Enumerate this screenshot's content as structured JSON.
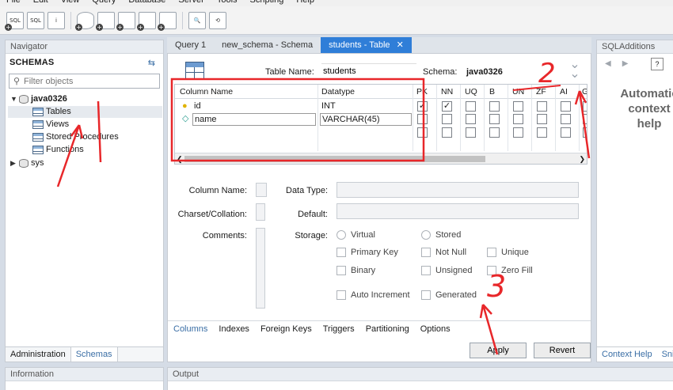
{
  "menu": [
    "File",
    "Edit",
    "View",
    "Query",
    "Database",
    "Server",
    "Tools",
    "Scripting",
    "Help"
  ],
  "toolbar": {
    "buttons": [
      {
        "icon": "new-sql-tab-icon",
        "text": "SQL"
      },
      {
        "icon": "open-sql-script-icon",
        "text": "SQL"
      },
      {
        "icon": "inspector-icon",
        "text": "i"
      },
      {
        "icon": "create-schema-icon",
        "text": ""
      },
      {
        "icon": "create-table-icon",
        "text": ""
      },
      {
        "icon": "create-view-icon",
        "text": ""
      },
      {
        "icon": "create-procedure-icon",
        "text": ""
      },
      {
        "icon": "create-function-icon",
        "text": ""
      },
      {
        "icon": "search-table-data-icon",
        "text": ""
      },
      {
        "icon": "reconnect-icon",
        "text": ""
      }
    ]
  },
  "navigator": {
    "title": "Navigator",
    "schemas_title": "SCHEMAS",
    "filter_placeholder": "Filter objects",
    "tree": {
      "db1": "java0326",
      "tables": "Tables",
      "views": "Views",
      "procedures": "Stored Procedures",
      "functions": "Functions",
      "db2": "sys"
    },
    "tabs": {
      "administration": "Administration",
      "schemas": "Schemas"
    }
  },
  "information": {
    "title": "Information"
  },
  "editor": {
    "tabs": [
      "Query 1",
      "new_schema - Schema",
      "students - Table"
    ],
    "close_glyph": "✕",
    "table_name_label": "Table Name:",
    "table_name_value": "students",
    "schema_label": "Schema:",
    "schema_value": "java0326",
    "grid": {
      "headers": [
        "Column Name",
        "Datatype",
        "PK",
        "NN",
        "UQ",
        "B",
        "UN",
        "ZF",
        "AI",
        "G"
      ],
      "rows": [
        {
          "name": "id",
          "datatype": "INT",
          "pk": true,
          "nn": true
        },
        {
          "name": "name",
          "datatype": "VARCHAR(45)",
          "pk": false,
          "nn": false
        }
      ]
    },
    "form": {
      "column_name_label": "Column Name:",
      "charset_label": "Charset/Collation:",
      "comments_label": "Comments:",
      "data_type_label": "Data Type:",
      "default_label": "Default:",
      "storage_label": "Storage:",
      "virtual": "Virtual",
      "stored": "Stored",
      "primary_key": "Primary Key",
      "not_null": "Not Null",
      "unique": "Unique",
      "binary": "Binary",
      "unsigned": "Unsigned",
      "zero_fill": "Zero Fill",
      "auto_increment": "Auto Increment",
      "generated": "Generated"
    },
    "detail_tabs": [
      "Columns",
      "Indexes",
      "Foreign Keys",
      "Triggers",
      "Partitioning",
      "Options"
    ],
    "apply": "Apply",
    "revert": "Revert"
  },
  "sql_additions": {
    "title": "SQLAdditions",
    "message": "Automatic context help",
    "tabs": {
      "context_help": "Context Help",
      "snippets": "Snippets"
    }
  },
  "output": {
    "title": "Output"
  },
  "annotations": {
    "label_2": "2",
    "label_3": "3"
  },
  "colors": {
    "accent": "#2f7ed8",
    "annotation": "#e8272a"
  }
}
